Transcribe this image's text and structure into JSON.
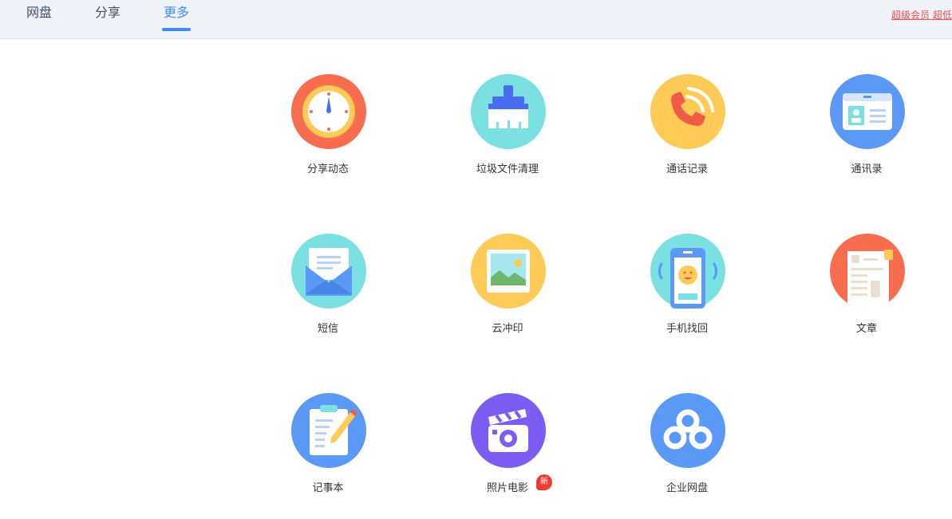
{
  "nav": {
    "tabs": [
      {
        "label": "网盘"
      },
      {
        "label": "分享"
      },
      {
        "label": "更多"
      }
    ],
    "active_tab": "更多",
    "promo_text": "超级会员 超低"
  },
  "apps": [
    {
      "label": "分享动态"
    },
    {
      "label": "垃圾文件清理"
    },
    {
      "label": "通话记录"
    },
    {
      "label": "通讯录"
    },
    {
      "label": "短信"
    },
    {
      "label": "云冲印"
    },
    {
      "label": "手机找回"
    },
    {
      "label": "文章"
    },
    {
      "label": "记事本"
    },
    {
      "label": "照片电影",
      "badge": "新"
    },
    {
      "label": "企业网盘"
    }
  ],
  "colors": {
    "accent": "#3b8cff",
    "badge": "#ec3a35",
    "promo": "#f04d4d"
  }
}
